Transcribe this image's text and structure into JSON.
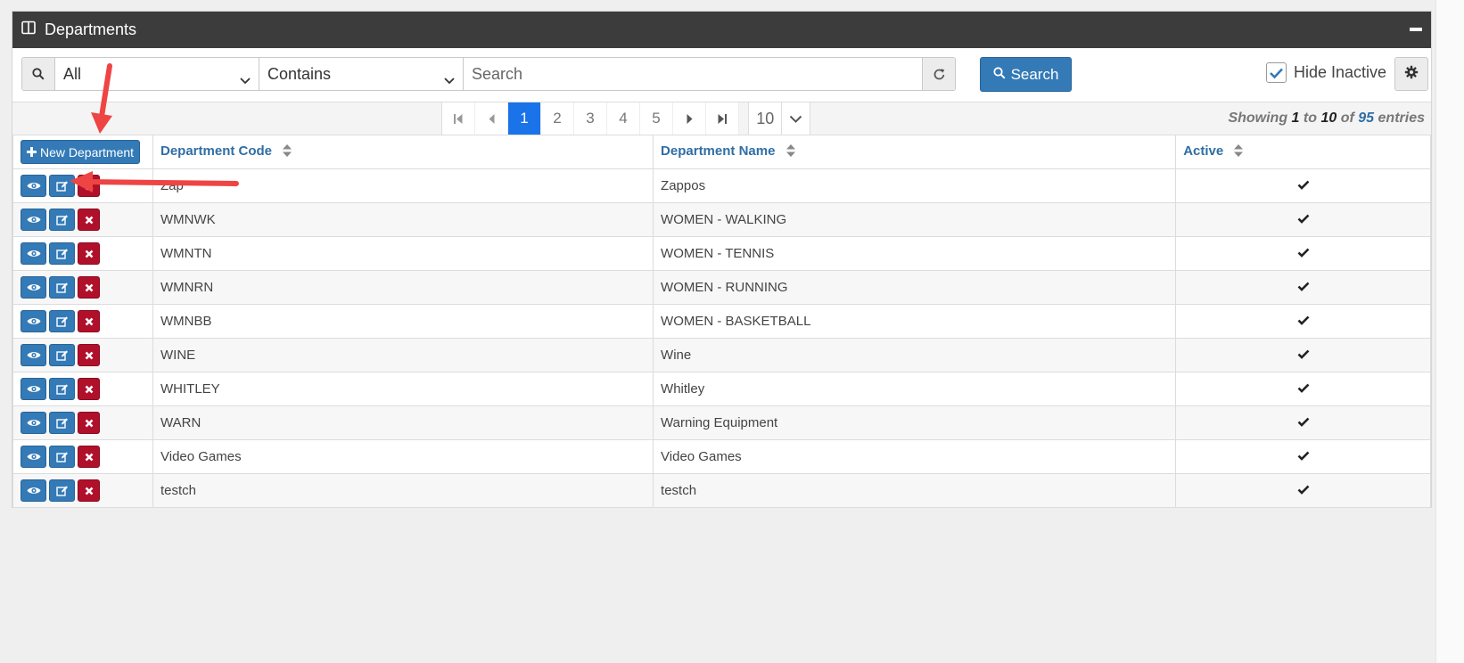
{
  "panel": {
    "title": "Departments"
  },
  "filter": {
    "field_value": "All",
    "operator_value": "Contains",
    "search_placeholder": "Search",
    "search_value": ""
  },
  "toolbar": {
    "search_label": "Search",
    "hide_inactive_label": "Hide Inactive",
    "hide_inactive_checked": true
  },
  "pager": {
    "pages": [
      "1",
      "2",
      "3",
      "4",
      "5"
    ],
    "active_page": "1",
    "page_size": "10",
    "showing_prefix": "Showing",
    "showing_from": "1",
    "showing_to_word": "to",
    "showing_to": "10",
    "showing_of_word": "of",
    "showing_total": "95",
    "showing_suffix": "entries"
  },
  "table": {
    "new_label": "New Department",
    "columns": [
      "Department Code",
      "Department Name",
      "Active"
    ],
    "rows": [
      {
        "code": "Zap",
        "name": "Zappos",
        "active": true
      },
      {
        "code": "WMNWK",
        "name": "WOMEN - WALKING",
        "active": true
      },
      {
        "code": "WMNTN",
        "name": "WOMEN - TENNIS",
        "active": true
      },
      {
        "code": "WMNRN",
        "name": "WOMEN - RUNNING",
        "active": true
      },
      {
        "code": "WMNBB",
        "name": "WOMEN - BASKETBALL",
        "active": true
      },
      {
        "code": "WINE",
        "name": "Wine",
        "active": true
      },
      {
        "code": "WHITLEY",
        "name": "Whitley",
        "active": true
      },
      {
        "code": "WARN",
        "name": "Warning Equipment",
        "active": true
      },
      {
        "code": "Video Games",
        "name": "Video Games",
        "active": true
      },
      {
        "code": "testch",
        "name": "testch",
        "active": true
      }
    ]
  },
  "colors": {
    "primary": "#337ab7",
    "danger": "#b0102a",
    "header_bg": "#3c3c3c",
    "link": "#2f6ea5",
    "annotation_arrow": "#ef4444"
  }
}
